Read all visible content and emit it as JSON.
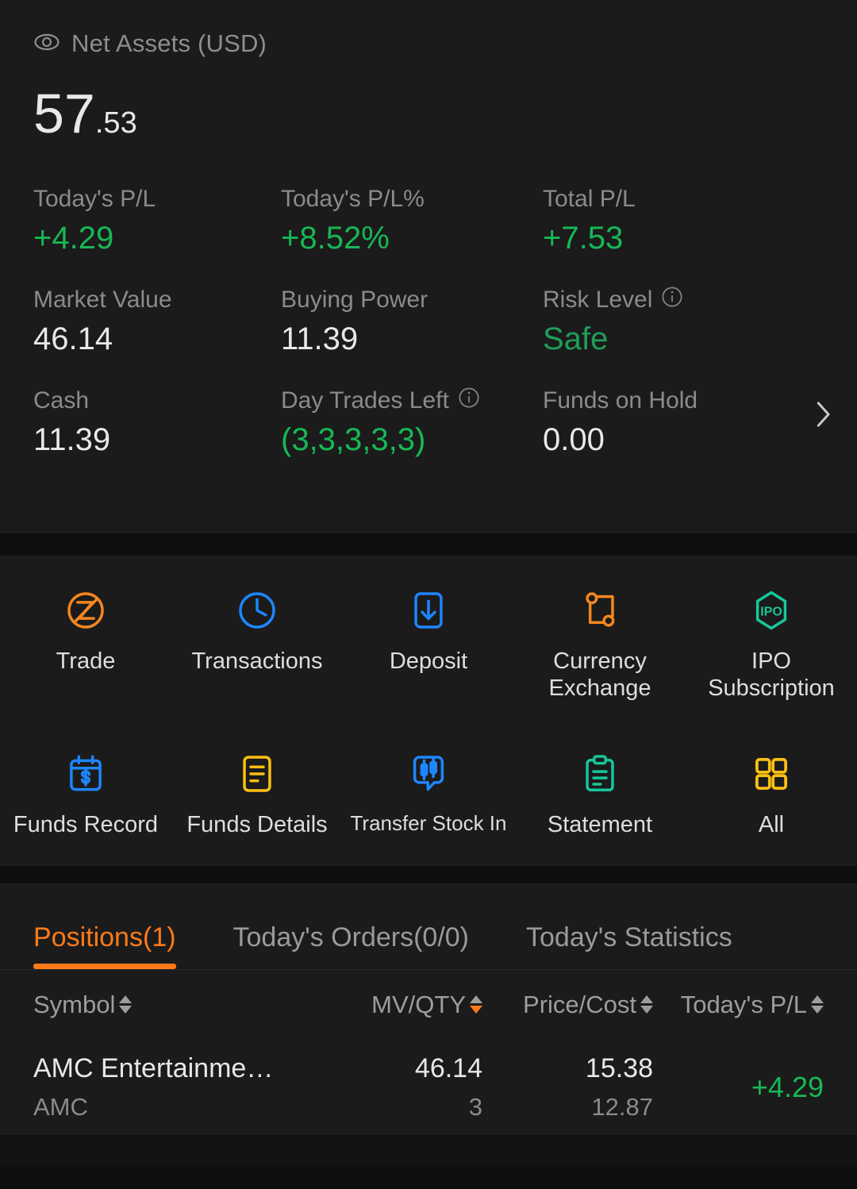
{
  "account": {
    "visibility_icon": "eye-icon",
    "net_assets_label": "Net Assets (USD)",
    "net_assets_whole": "57",
    "net_assets_cents": ".53",
    "stats": [
      {
        "label": "Today's P/L",
        "value": "+4.29",
        "tone": "pos",
        "info": false
      },
      {
        "label": "Today's P/L%",
        "value": "+8.52%",
        "tone": "pos",
        "info": false
      },
      {
        "label": "Total P/L",
        "value": "+7.53",
        "tone": "pos",
        "info": false
      },
      {
        "label": "Market Value",
        "value": "46.14",
        "tone": "neutral",
        "info": false
      },
      {
        "label": "Buying Power",
        "value": "11.39",
        "tone": "neutral",
        "info": false
      },
      {
        "label": "Risk Level",
        "value": "Safe",
        "tone": "safe",
        "info": true
      },
      {
        "label": "Cash",
        "value": "11.39",
        "tone": "neutral",
        "info": false
      },
      {
        "label": "Day Trades Left",
        "value": "(3,3,3,3,3)",
        "tone": "pos",
        "info": true
      },
      {
        "label": "Funds on Hold",
        "value": "0.00",
        "tone": "neutral",
        "info": false
      }
    ],
    "detail_chevron": "chevron-right-icon"
  },
  "shortcuts": {
    "row1": [
      {
        "icon": "trade-icon",
        "label": "Trade"
      },
      {
        "icon": "clock-icon",
        "label": "Transactions"
      },
      {
        "icon": "deposit-down-arrow-icon",
        "label": "Deposit"
      },
      {
        "icon": "currency-exchange-icon",
        "label": "Currency\nExchange"
      },
      {
        "icon": "ipo-hexagon-icon",
        "label": "IPO Subscription"
      }
    ],
    "row2": [
      {
        "icon": "calendar-dollar-icon",
        "label": "Funds Record"
      },
      {
        "icon": "document-lines-icon",
        "label": "Funds Details"
      },
      {
        "icon": "candlestick-bubble-icon",
        "label": "Transfer Stock In"
      },
      {
        "icon": "clipboard-icon",
        "label": "Statement"
      },
      {
        "icon": "grid-four-icon",
        "label": "All"
      }
    ]
  },
  "tabs": [
    {
      "label": "Positions(1)",
      "active": true
    },
    {
      "label": "Today's Orders(0/0)",
      "active": false
    },
    {
      "label": "Today's Statistics",
      "active": false
    }
  ],
  "positions_table": {
    "columns": [
      {
        "label": "Symbol",
        "sort": "none"
      },
      {
        "label": "MV/QTY",
        "sort": "desc"
      },
      {
        "label": "Price/Cost",
        "sort": "none"
      },
      {
        "label": "Today's P/L",
        "sort": "none"
      }
    ],
    "rows": [
      {
        "name": "AMC Entertainme…",
        "ticker": "AMC",
        "mv": "46.14",
        "qty": "3",
        "price": "15.38",
        "cost": "12.87",
        "todays_pl": "+4.29"
      }
    ]
  },
  "colors": {
    "accent": "#ff7a18",
    "positive": "#17b855",
    "safe": "#1f9e5a",
    "card": "#1b1b1b",
    "page": "#121212"
  }
}
